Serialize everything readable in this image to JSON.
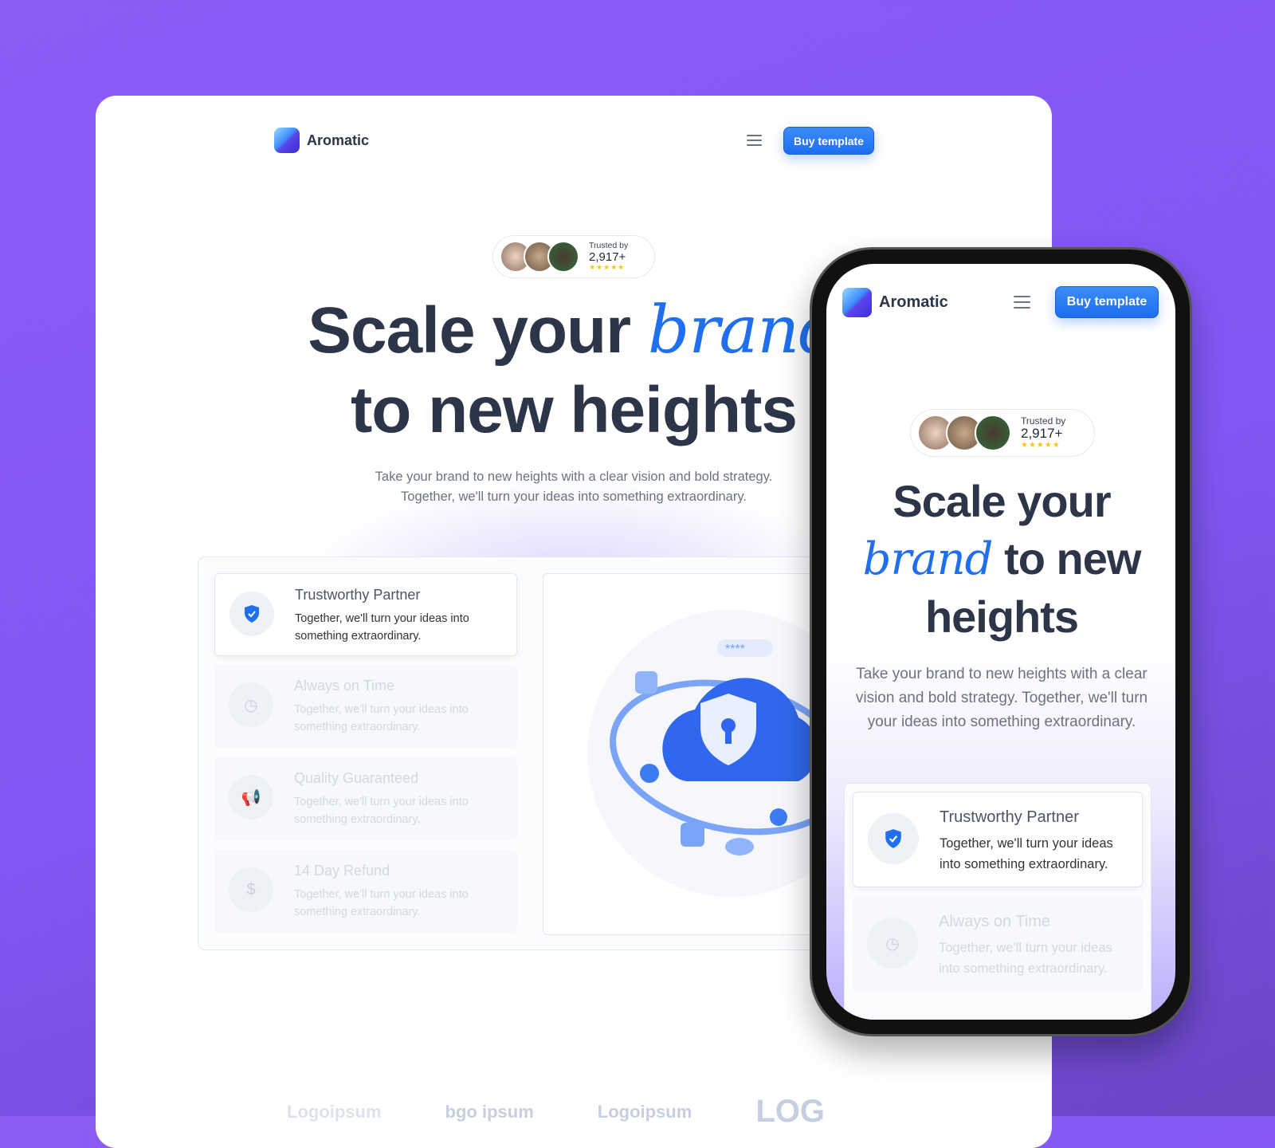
{
  "brand": "Aromatic",
  "nav": {
    "buy_label": "Buy template"
  },
  "trust": {
    "label": "Trusted by",
    "count": "2,917+",
    "stars": "★★★★★",
    "rating": 5
  },
  "hero": {
    "line1": "Scale your",
    "accent": "brand",
    "line2": "to new heights",
    "mobile_line3": "to new",
    "mobile_line4": "heights",
    "subtitle_1": "Take your brand to new heights with a clear vision and bold strategy.",
    "subtitle_2": "Together, we'll turn your ideas into something extraordinary.",
    "mobile_subtitle": "Take your brand to new heights with a clear vision and bold strategy. Together, we'll turn your ideas into something extraordinary."
  },
  "features": [
    {
      "title": "Trustworthy Partner",
      "text": "Together, we'll turn your ideas into something extraordinary.",
      "icon": "shield-check-icon",
      "active": true
    },
    {
      "title": "Always on Time",
      "text": "Together, we'll turn your ideas into something extraordinary.",
      "icon": "clock-icon"
    },
    {
      "title": "Quality Guaranteed",
      "text": "Together, we'll turn your ideas into something extraordinary.",
      "icon": "megaphone-icon"
    },
    {
      "title": "14 Day Refund",
      "text": "Together, we'll turn your ideas into something extraordinary.",
      "icon": "dollar-icon"
    }
  ],
  "illustration": {
    "password_mask": "****"
  },
  "logos": [
    "Logoipsum",
    "bgo ipsum",
    "Logoipsum",
    "LOG"
  ],
  "colors": {
    "accent": "#1f6ff0",
    "background": "#8b5cf6"
  }
}
